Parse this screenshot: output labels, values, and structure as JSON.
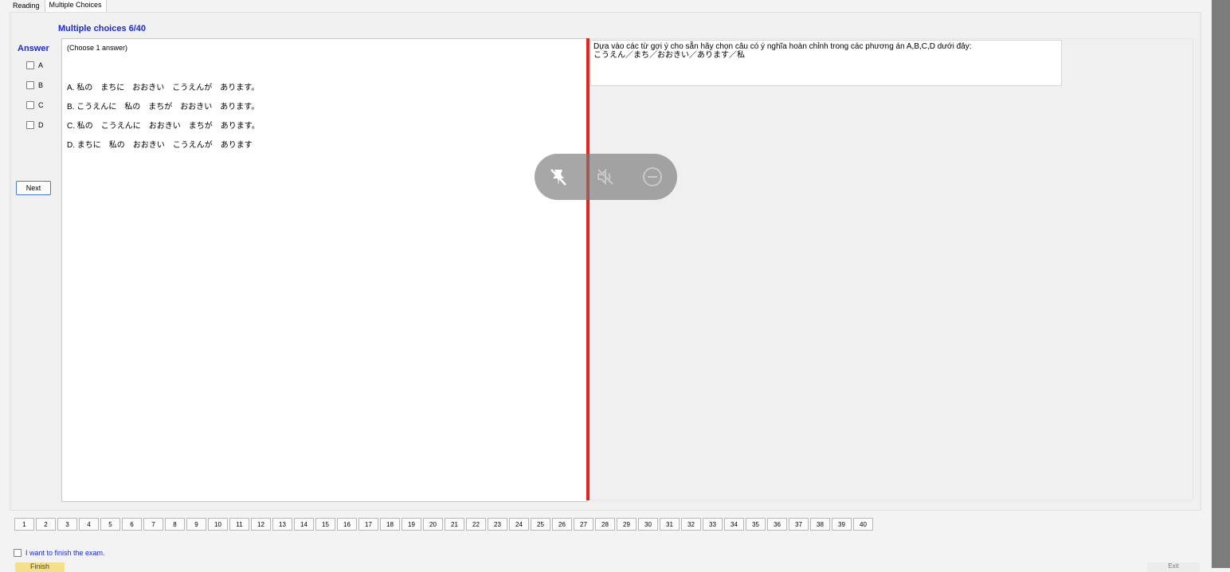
{
  "tabs": [
    "Reading",
    "Multiple Choices"
  ],
  "question_header": "Multiple choices 6/40",
  "answer_label": "Answer",
  "options": [
    "A",
    "B",
    "C",
    "D"
  ],
  "next_label": "Next",
  "choose_instruction": "(Choose 1 answer)",
  "choices": [
    "A. 私の　まちに　おおきい　こうえんが　あります。",
    "B. こうえんに　私の　まちが　おおきい　あります。",
    "C. 私の　こうえんに　おおきい　まちが　あります。",
    "D. まちに　私の　おおきい　こうえんが　あります"
  ],
  "question_text": {
    "line1": "Dựa vào các từ gợi ý cho sẵn hãy chọn câu có ý nghĩa hoàn chỉnh trong các phương án A,B,C,D dưới đây:",
    "line2": "こうえん／まち／おおきい／あります／私"
  },
  "overlay_icons": [
    "unpin-icon",
    "mute-icon",
    "minus-circle-icon"
  ],
  "pages": [
    "1",
    "2",
    "3",
    "4",
    "5",
    "6",
    "7",
    "8",
    "9",
    "10",
    "11",
    "12",
    "13",
    "14",
    "15",
    "16",
    "17",
    "18",
    "19",
    "20",
    "21",
    "22",
    "23",
    "24",
    "25",
    "26",
    "27",
    "28",
    "29",
    "30",
    "31",
    "32",
    "33",
    "34",
    "35",
    "36",
    "37",
    "38",
    "39",
    "40"
  ],
  "finish_checkbox_label": "I want to finish the exam.",
  "finish_button": "Finish",
  "exit_button": "Exit",
  "colors": {
    "accent": "#1c2bd6",
    "divider": "#e0261b",
    "finish": "#f4e08a"
  }
}
